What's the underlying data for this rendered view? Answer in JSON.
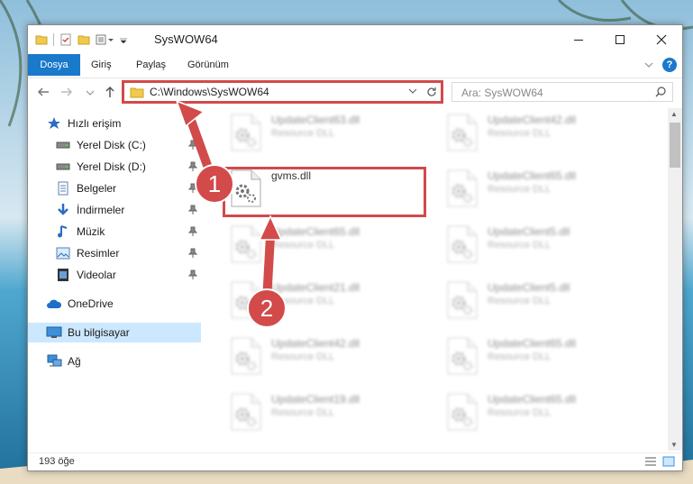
{
  "window": {
    "title": "SysWOW64"
  },
  "ribbon": {
    "tabs": [
      "Dosya",
      "Giriş",
      "Paylaş",
      "Görünüm"
    ]
  },
  "nav": {
    "address": "C:\\Windows\\SysWOW64",
    "search_placeholder": "Ara: SysWOW64"
  },
  "sidebar": {
    "items": [
      {
        "label": "Hızlı erişim",
        "icon": "star-icon"
      },
      {
        "label": "Yerel Disk (C:)",
        "icon": "drive-icon"
      },
      {
        "label": "Yerel Disk (D:)",
        "icon": "drive-icon"
      },
      {
        "label": "Belgeler",
        "icon": "document-icon"
      },
      {
        "label": "İndirmeler",
        "icon": "download-icon"
      },
      {
        "label": "Müzik",
        "icon": "music-icon"
      },
      {
        "label": "Resimler",
        "icon": "pictures-icon"
      },
      {
        "label": "Videolar",
        "icon": "video-icon"
      },
      {
        "label": "OneDrive",
        "icon": "cloud-icon"
      },
      {
        "label": "Bu bilgisayar",
        "icon": "computer-icon"
      },
      {
        "label": "Ağ",
        "icon": "network-icon"
      }
    ]
  },
  "files": {
    "highlighted": {
      "name": "gvms.dll"
    },
    "blurred": [
      {
        "name": "UpdateClient63.dll",
        "type": "Resource DLL"
      },
      {
        "name": "UpdateClient42.dll",
        "type": "Resource DLL"
      },
      {
        "name": "UpdateClient65.dll",
        "type": "Resource DLL"
      },
      {
        "name": "UpdateClient65.dll",
        "type": "Resource DLL"
      },
      {
        "name": "UpdateClient5.dll",
        "type": "Resource DLL"
      },
      {
        "name": "UpdateClient21.dll",
        "type": "Resource DLL"
      },
      {
        "name": "UpdateClient5.dll",
        "type": "Resource DLL"
      },
      {
        "name": "UpdateClient42.dll",
        "type": "Resource DLL"
      },
      {
        "name": "UpdateClient65.dll",
        "type": "Resource DLL"
      },
      {
        "name": "UpdateClient19.dll",
        "type": "Resource DLL"
      },
      {
        "name": "UpdateClient65.dll",
        "type": "Resource DLL"
      }
    ]
  },
  "status": {
    "count": "193 öğe"
  },
  "annotations": {
    "badge1": "1",
    "badge2": "2"
  },
  "colors": {
    "accent": "#1979ca",
    "highlight": "#d24a4a",
    "selection": "#cce8ff"
  }
}
